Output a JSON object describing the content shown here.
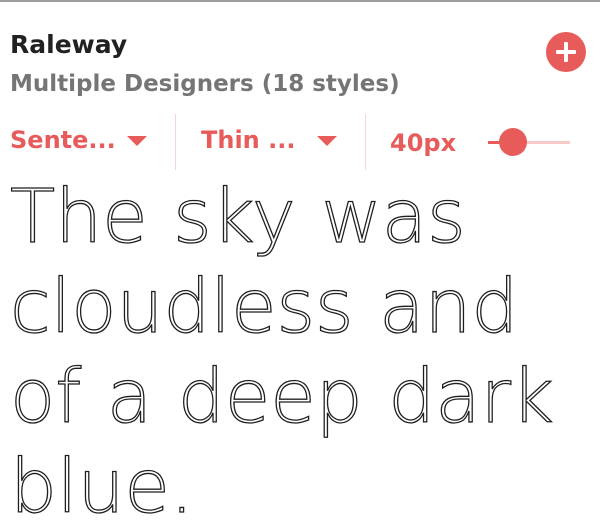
{
  "font_card": {
    "font_name": "Raleway",
    "designer": "Multiple Designers (18 styles)",
    "add_icon": "plus-icon",
    "add_color": "#e85b5b"
  },
  "controls": {
    "preview_mode": {
      "label": "Sente...",
      "icon": "caret-down-icon"
    },
    "style": {
      "label": "Thin ...",
      "icon": "caret-down-icon"
    },
    "size_label": "40px",
    "size_slider_fraction": 0.3
  },
  "preview_text": "The sky was cloudless and of a deep dark blue."
}
